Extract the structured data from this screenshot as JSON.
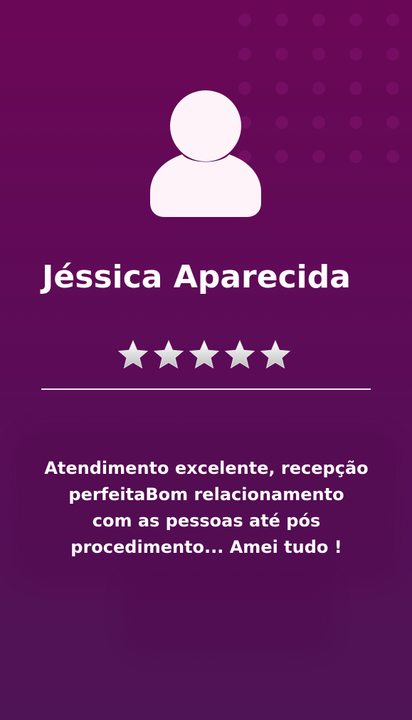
{
  "testimonial": {
    "name": "Jéssica Aparecida",
    "rating": 5,
    "rating_max": 5,
    "review_lines": [
      "Atendimento excelente, recepção",
      "perfeitaBom relacionamento",
      "com as pessoas até pós",
      "procedimento... Amei tudo !"
    ]
  },
  "icons": {
    "avatar": "user-silhouette-icon",
    "star": "star-icon"
  },
  "colors": {
    "background_top": "#6b0757",
    "background_bottom": "#4f1456",
    "avatar_fill": "#fdf3f9",
    "text": "#ffffff",
    "divider": "#f2e6ef",
    "star_fill": "#dcdcdc"
  }
}
